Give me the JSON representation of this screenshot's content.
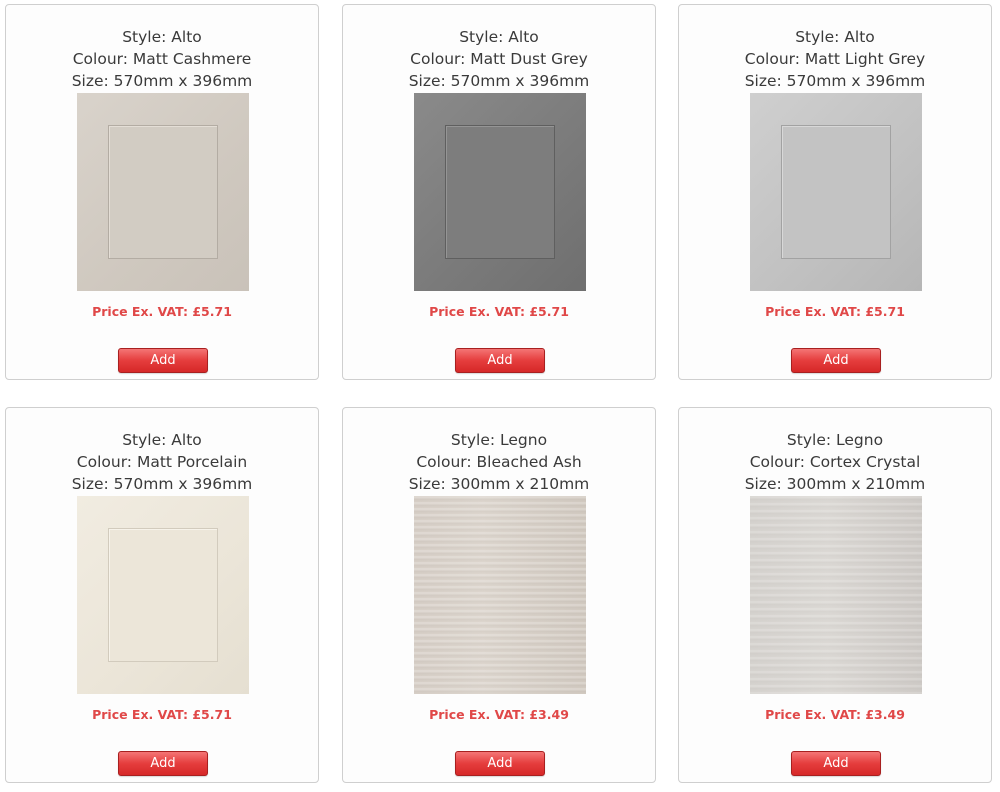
{
  "products": [
    {
      "style": "Style: Alto",
      "colour": "Colour: Matt Cashmere",
      "size": "Size: 570mm x 396mm",
      "price": "Price Ex. VAT: £5.71",
      "button": "Add",
      "swatch": "#d2ccc3"
    },
    {
      "style": "Style: Alto",
      "colour": "Colour: Matt Dust Grey",
      "size": "Size: 570mm x 396mm",
      "price": "Price Ex. VAT: £5.71",
      "button": "Add",
      "swatch": "#7d7d7d"
    },
    {
      "style": "Style: Alto",
      "colour": "Colour: Matt Light Grey",
      "size": "Size: 570mm x 396mm",
      "price": "Price Ex. VAT: £5.71",
      "button": "Add",
      "swatch": "#c3c3c3"
    },
    {
      "style": "Style: Alto",
      "colour": "Colour: Matt Porcelain",
      "size": "Size: 570mm x 396mm",
      "price": "Price Ex. VAT: £5.71",
      "button": "Add",
      "swatch": "#ece6d9"
    },
    {
      "style": "Style: Legno",
      "colour": "Colour: Bleached Ash",
      "size": "Size: 300mm x 210mm",
      "price": "Price Ex. VAT: £3.49",
      "button": "Add",
      "swatch": "#d7cfc7"
    },
    {
      "style": "Style: Legno",
      "colour": "Colour: Cortex Crystal",
      "size": "Size: 300mm x 210mm",
      "price": "Price Ex. VAT: £3.49",
      "button": "Add",
      "swatch": "#d6d3cf"
    }
  ],
  "colors": {
    "price_text": "#e04848",
    "button_bg": "#e53d3d",
    "heading_text": "#3a3a3a"
  }
}
